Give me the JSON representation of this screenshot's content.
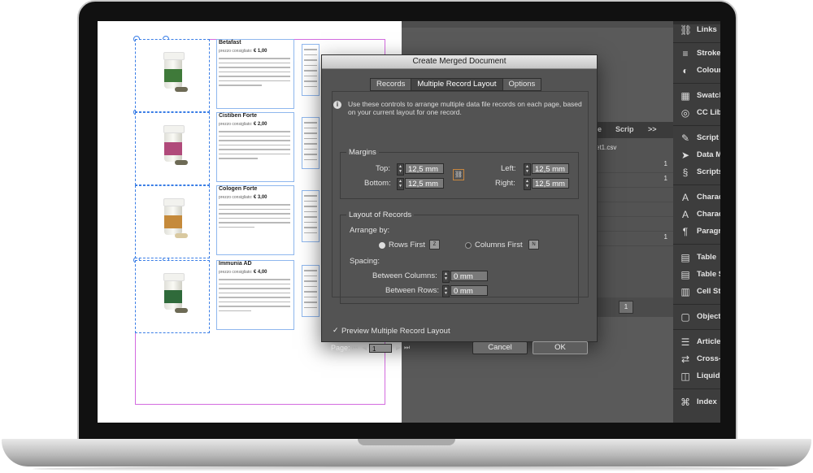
{
  "dialog": {
    "title": "Create Merged Document",
    "tabs": [
      "Records",
      "Multiple Record Layout",
      "Options"
    ],
    "active_tab": "Multiple Record Layout",
    "info_text": "Use these controls to arrange multiple data file records on each page, based on your current layout for one record.",
    "margins": {
      "title": "Margins",
      "top_label": "Top:",
      "top_value": "12,5 mm",
      "bottom_label": "Bottom:",
      "bottom_value": "12,5 mm",
      "left_label": "Left:",
      "left_value": "12,5 mm",
      "right_label": "Right:",
      "right_value": "12,5 mm"
    },
    "layout": {
      "title": "Layout of Records",
      "arrange_by_label": "Arrange by:",
      "rows_first_label": "Rows First",
      "columns_first_label": "Columns First",
      "selected": "Rows First",
      "spacing_label": "Spacing:",
      "between_columns_label": "Between Columns:",
      "between_columns_value": "0 mm",
      "between_rows_label": "Between Rows:",
      "between_rows_value": "0 mm"
    },
    "preview_label": "Preview Multiple Record Layout",
    "preview_checked": true,
    "page_label": "Page:",
    "page_value": "1",
    "cancel_label": "Cancel",
    "ok_label": "OK"
  },
  "records": [
    {
      "name": "Betafast",
      "price_label": "prezzo consigliato:",
      "price": "€ 1,00"
    },
    {
      "name": "Cistiben Forte",
      "price_label": "prezzo consigliato:",
      "price": "€ 2,00"
    },
    {
      "name": "Cologen Forte",
      "price_label": "prezzo consigliato:",
      "price": "€ 3,00"
    },
    {
      "name": "Immunia AD",
      "price_label": "prezzo consigliato:",
      "price": "€ 4,00"
    }
  ],
  "data_merge_panel": {
    "tabs": [
      "e",
      "Scrip",
      ">>"
    ],
    "file_name": "et1.csv",
    "row_values": [
      "1",
      "1",
      "1"
    ],
    "page_value": "1"
  },
  "dock": [
    {
      "icon": "links-icon",
      "glyph": "⛓",
      "label": "Links"
    },
    {
      "icon": "stroke-icon",
      "glyph": "≡",
      "label": "Stroke"
    },
    {
      "icon": "colour-icon",
      "glyph": "◐",
      "label": "Colour"
    },
    {
      "icon": "swatches-icon",
      "glyph": "▦",
      "label": "Swatches"
    },
    {
      "icon": "cc-libraries-icon",
      "glyph": "◎",
      "label": "CC Libraries"
    },
    {
      "icon": "script-label-icon",
      "glyph": "✎",
      "label": "Script Label"
    },
    {
      "icon": "data-merge-icon",
      "glyph": "➤",
      "label": "Data Merge"
    },
    {
      "icon": "scripts-icon",
      "glyph": "§",
      "label": "Scripts"
    },
    {
      "icon": "character-icon",
      "glyph": "A",
      "label": "Character"
    },
    {
      "icon": "character-styles-icon",
      "glyph": "A",
      "label": "Character Styles"
    },
    {
      "icon": "paragraph-icon",
      "glyph": "¶",
      "label": "Paragraph"
    },
    {
      "icon": "table-icon",
      "glyph": "▤",
      "label": "Table"
    },
    {
      "icon": "table-styles-icon",
      "glyph": "▤",
      "label": "Table Styles"
    },
    {
      "icon": "cell-styles-icon",
      "glyph": "▥",
      "label": "Cell Styles"
    },
    {
      "icon": "object-styles-icon",
      "glyph": "▢",
      "label": "Object Styles"
    },
    {
      "icon": "articles-icon",
      "glyph": "☰",
      "label": "Articles"
    },
    {
      "icon": "cross-references-icon",
      "glyph": "⇄",
      "label": "Cross-References"
    },
    {
      "icon": "liquid-layout-icon",
      "glyph": "◫",
      "label": "Liquid Layout"
    },
    {
      "icon": "index-icon",
      "glyph": "⌘",
      "label": "Index"
    }
  ]
}
